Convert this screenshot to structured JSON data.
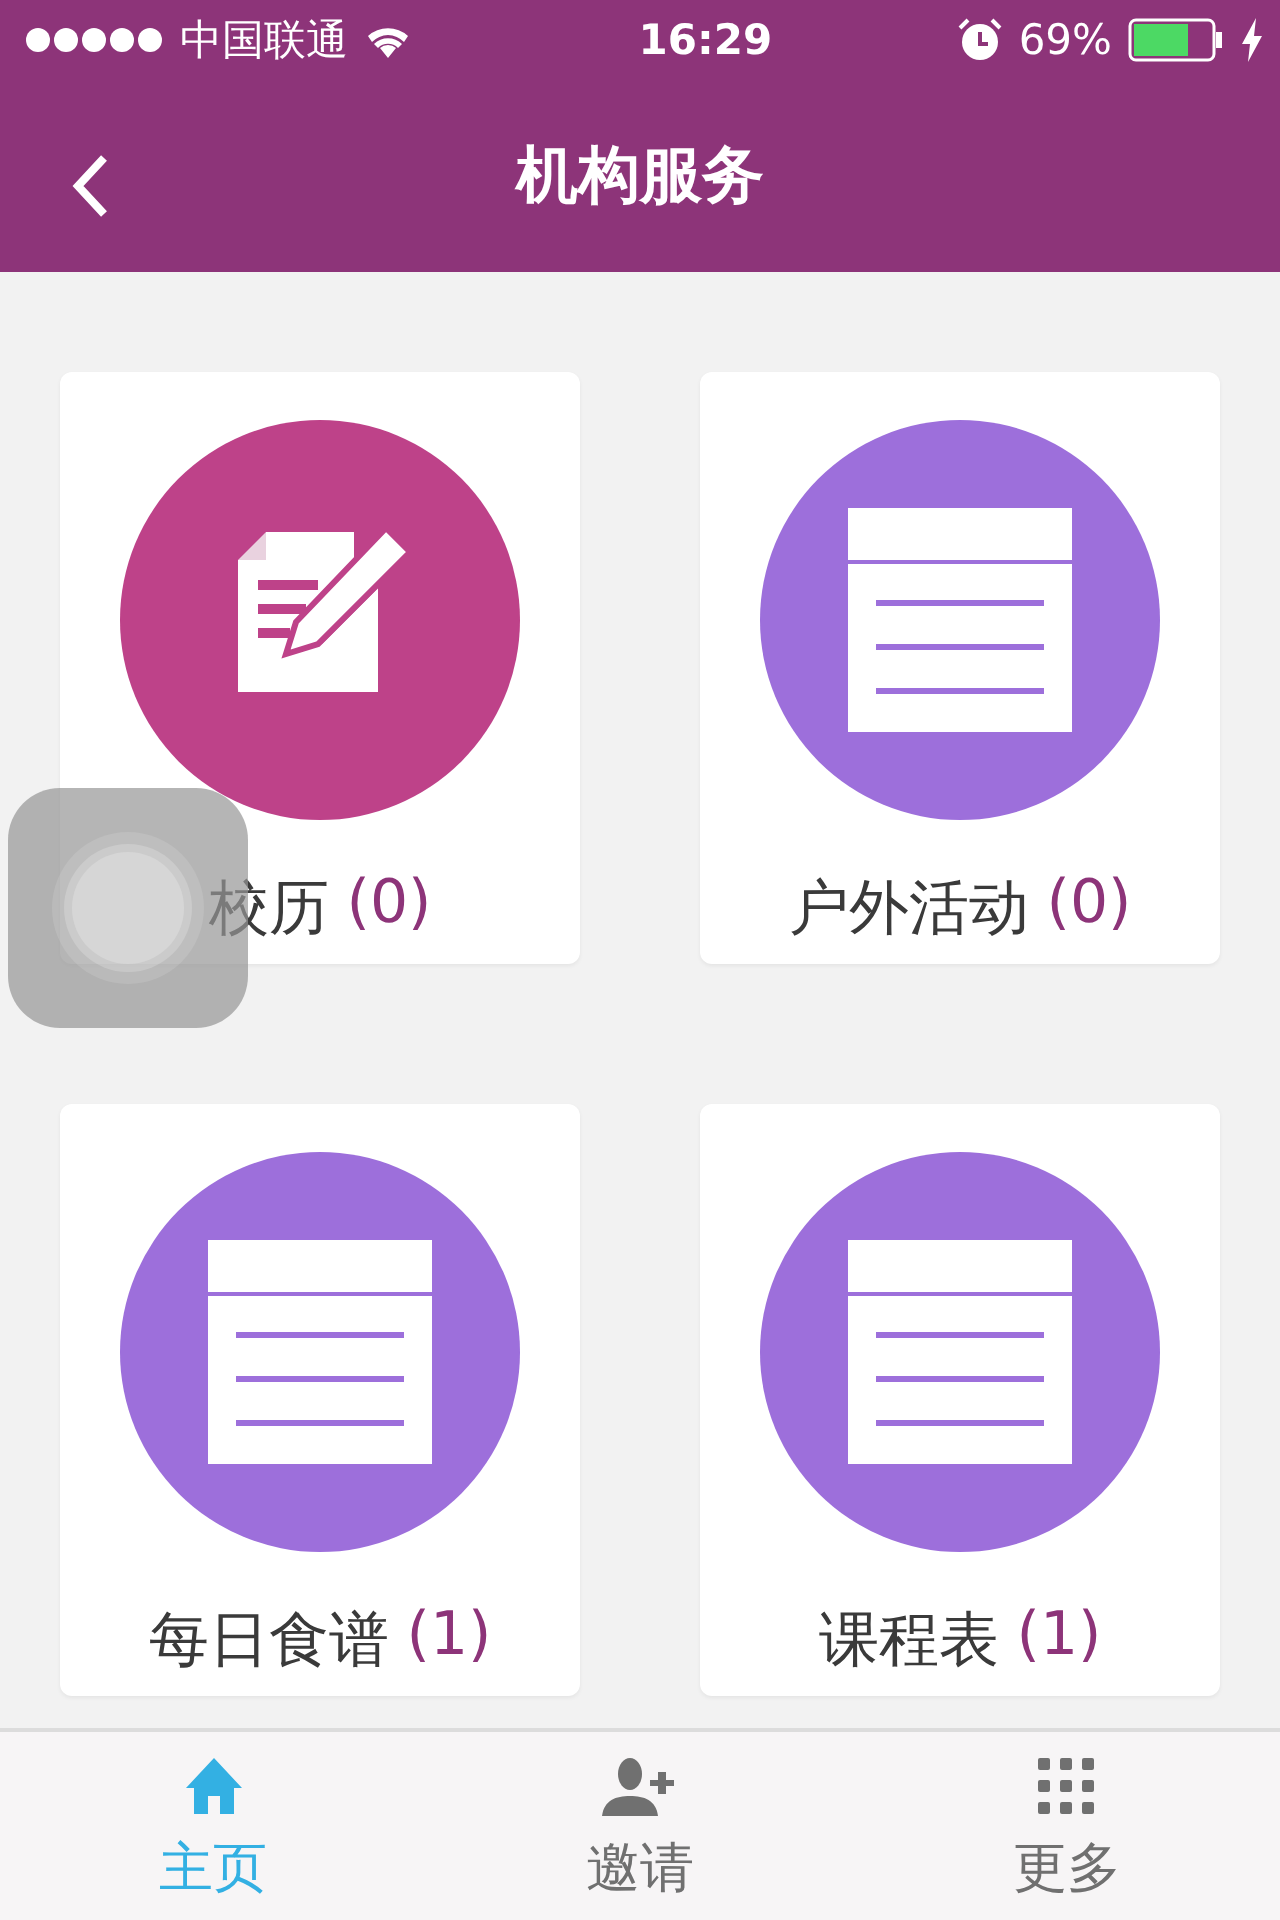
{
  "status_bar": {
    "carrier": "中国联通",
    "time": "16:29",
    "battery": "69%"
  },
  "nav": {
    "title": "机构服务"
  },
  "cards": [
    {
      "kind": "note",
      "label": "校历",
      "count": "(0)",
      "color": "#be4289"
    },
    {
      "kind": "list",
      "label": "户外活动",
      "count": "(0)",
      "color": "#9d6fdb"
    },
    {
      "kind": "list",
      "label": "每日食谱",
      "count": "(1)",
      "color": "#9d6fdb"
    },
    {
      "kind": "list",
      "label": "课程表",
      "count": "(1)",
      "color": "#9d6fdb"
    }
  ],
  "tabs": [
    {
      "kind": "home",
      "label": "主页",
      "selected": true
    },
    {
      "kind": "invite",
      "label": "邀请",
      "selected": false
    },
    {
      "kind": "more",
      "label": "更多",
      "selected": false
    }
  ]
}
